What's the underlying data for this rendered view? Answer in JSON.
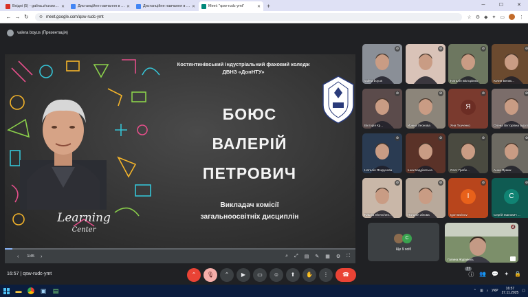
{
  "browser": {
    "tabs": [
      {
        "title": "Вхідні (5) - galina.zhurawel@ict",
        "color": "#d93025"
      },
      {
        "title": "Дистанційне навчання в ВСП",
        "color": "#4285f4"
      },
      {
        "title": "Дистанційне навчання в ВСП",
        "color": "#4285f4"
      },
      {
        "title": "Meet: \"qsw-rudc-ymt\"",
        "color": "#00897b",
        "active": true
      }
    ],
    "url": "meet.google.com/qsw-rudc-ymt"
  },
  "meet": {
    "presenter_tag": "valera boyus (Презентація)",
    "meeting_code": "qsw-rudc-ymt",
    "clock": "16:57",
    "people_badge": "27",
    "slide": {
      "college_line1": "Костянтинівський індустріальний фаховий коледж",
      "college_line2": "ДВНЗ «ДонНТУ»",
      "name_line1": "БОЮС",
      "name_line2": "ВАЛЕРІЙ",
      "name_line3": "ПЕТРОВИЧ",
      "position_line1": "Викладач комісії",
      "position_line2": "загальноосвітніх дисциплін",
      "logo_line1": "Learning",
      "logo_line2": "Center",
      "page": "1/45",
      "progress": 0.022
    },
    "participants": [
      {
        "name": "valera boyus",
        "bg": "#8a8f97",
        "type": "cam"
      },
      {
        "name": "",
        "bg": "#d9c3b8",
        "type": "cam"
      },
      {
        "name": "Наталія Вікторівна",
        "bg": "#6d7760",
        "type": "cam"
      },
      {
        "name": "Юлия Белик...",
        "bg": "#6b4a2f",
        "type": "cam"
      },
      {
        "name": "Вікторія Кр...",
        "bg": "#5b4b4b",
        "type": "cam"
      },
      {
        "name": "Ирина Леонова",
        "bg": "#8c857a",
        "type": "cam"
      },
      {
        "name": "Яна Ткаченко",
        "bg": "#7a3a2e",
        "type": "letter",
        "letter": "Я",
        "lbg": "#6c2d24"
      },
      {
        "name": "Олена Вікторівна Бурлак",
        "bg": "#7b6d6a",
        "type": "cam"
      },
      {
        "name": "Наталія Яскрунова",
        "bg": "#2a3b52",
        "type": "cam"
      },
      {
        "name": "Інна Бардієвська",
        "bg": "#5a3228",
        "type": "cam"
      },
      {
        "name": "Олег Гребе...",
        "bg": "#4a4a40",
        "type": "cam"
      },
      {
        "name": "Анна Ярмак",
        "bg": "#6d6a62",
        "type": "cam"
      },
      {
        "name": "Natalia Shevchen...",
        "bg": "#c9b7a8",
        "type": "cam"
      },
      {
        "name": "Наталія Зінова",
        "bg": "#b8a99b",
        "type": "cam"
      },
      {
        "name": "Igor Barinov",
        "bg": "#b8451c",
        "type": "letter",
        "letter": "I",
        "lbg": "#e8611a"
      },
      {
        "name": "Сергій Іванович ...",
        "bg": "#0f5b52",
        "type": "letter",
        "letter": "С",
        "lbg": "#108373"
      }
    ],
    "others": {
      "label": "Ще 9 осіб",
      "letter": "C"
    },
    "self_tile": {
      "name": "Галина Журавель",
      "bg": "#6a7f5a"
    }
  },
  "taskbar": {
    "lang": "УКР",
    "time": "16:57",
    "date": "27.11.2025"
  }
}
